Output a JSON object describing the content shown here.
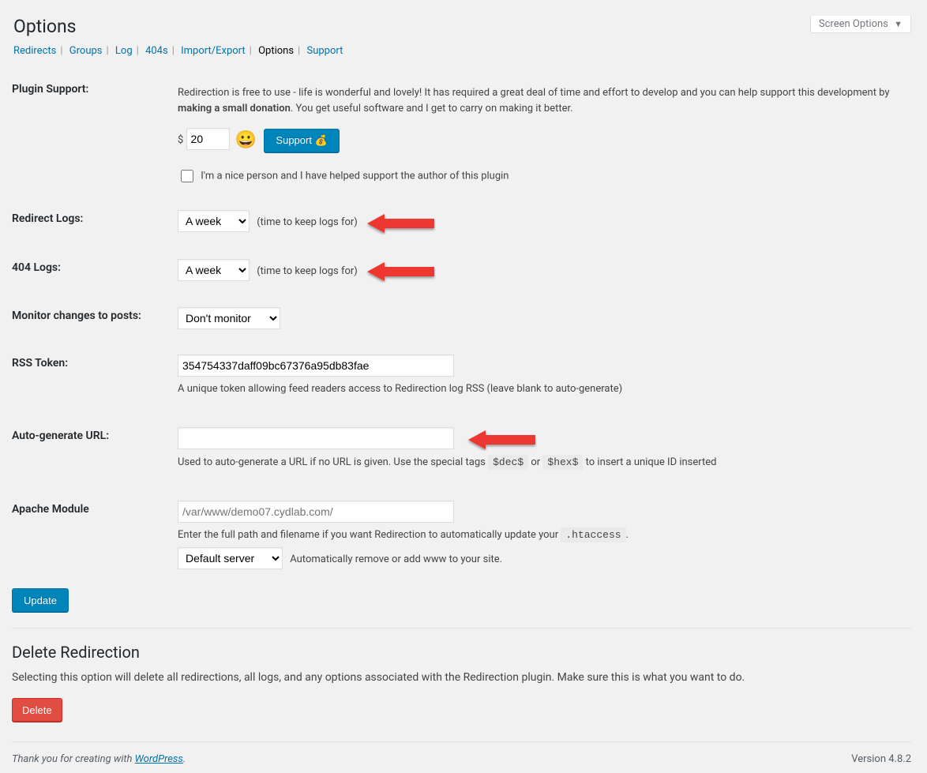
{
  "screenOptions": "Screen Options",
  "pageTitle": "Options",
  "tabs": {
    "redirects": "Redirects",
    "groups": "Groups",
    "log": "Log",
    "404s": "404s",
    "importExport": "Import/Export",
    "options": "Options",
    "support": "Support"
  },
  "pluginSupport": {
    "label": "Plugin Support:",
    "desc1a": "Redirection is free to use - life is wonderful and lovely! It has required a great deal of time and effort to develop and you can help support this development by ",
    "desc1b": "making a small donation",
    "desc1c": ". You get useful software and I get to carry on making it better.",
    "currency": "$",
    "amount": "20",
    "emoji": "😀",
    "supportBtn": "Support 💰",
    "niceCheckbox": "I'm a nice person and I have helped support the author of this plugin"
  },
  "redirectLogs": {
    "label": "Redirect Logs:",
    "value": "A week",
    "note": "(time to keep logs for)"
  },
  "logs404": {
    "label": "404 Logs:",
    "value": "A week",
    "note": "(time to keep logs for)"
  },
  "monitor": {
    "label": "Monitor changes to posts:",
    "value": "Don't monitor"
  },
  "rss": {
    "label": "RSS Token:",
    "value": "354754337daff09bc67376a95db83fae",
    "note": "A unique token allowing feed readers access to Redirection log RSS (leave blank to auto-generate)"
  },
  "autoUrl": {
    "label": "Auto-generate URL:",
    "value": "",
    "note1": "Used to auto-generate a URL if no URL is given. Use the special tags ",
    "tag1": "$dec$",
    "or": " or ",
    "tag2": "$hex$",
    "note2": " to insert a unique ID inserted"
  },
  "apache": {
    "label": "Apache Module",
    "placeholder": "/var/www/demo07.cydlab.com/",
    "note1": "Enter the full path and filename if you want Redirection to automatically update your ",
    "tag": ".htaccess",
    "note2": ".",
    "serverSelect": "Default server",
    "wwwNote": "Automatically remove or add www to your site."
  },
  "updateBtn": "Update",
  "delete": {
    "heading": "Delete Redirection",
    "desc": "Selecting this option will delete all redirections, all logs, and any options associated with the Redirection plugin. Make sure this is what you want to do.",
    "btn": "Delete"
  },
  "footer": {
    "thank": "Thank you for creating with ",
    "wp": "WordPress",
    "period": ".",
    "version": "Version 4.8.2"
  }
}
